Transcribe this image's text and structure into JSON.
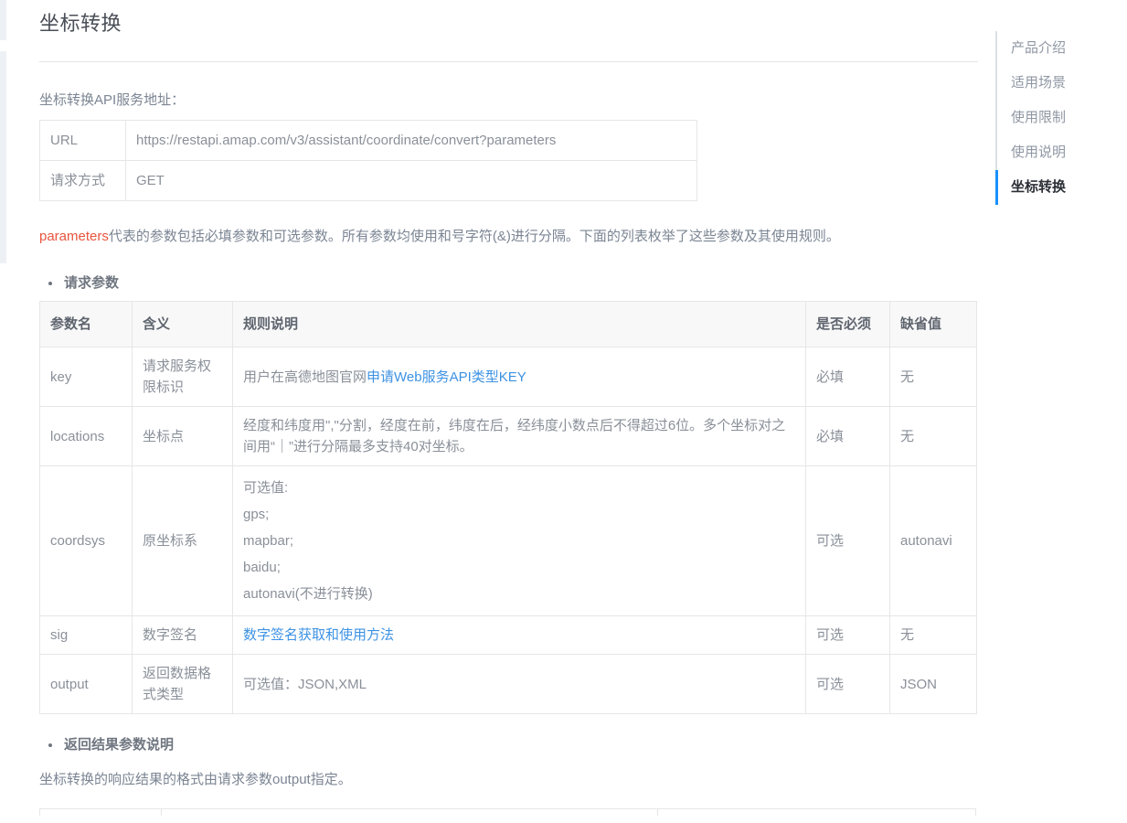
{
  "page": {
    "title": "坐标转换",
    "lead": "坐标转换API服务地址："
  },
  "service_table": {
    "rows": [
      {
        "label": "URL",
        "value": "https://restapi.amap.com/v3/assistant/coordinate/convert?parameters"
      },
      {
        "label": "请求方式",
        "value": "GET"
      }
    ]
  },
  "paragraph": {
    "code": "parameters",
    "text": "代表的参数包括必填参数和可选参数。所有参数均使用和号字符(&)进行分隔。下面的列表枚举了这些参数及其使用规则。"
  },
  "sections": {
    "request_params_heading": "请求参数",
    "response_params_heading": "返回结果参数说明",
    "response_note": "坐标转换的响应结果的格式由请求参数output指定。"
  },
  "param_table": {
    "headers": [
      "参数名",
      "含义",
      "规则说明",
      "是否必须",
      "缺省值"
    ],
    "rows": [
      {
        "name": "key",
        "meaning": "请求服务权限标识",
        "rule_prefix": "用户在高德地图官网",
        "rule_link": "申请Web服务API类型KEY",
        "rule_suffix": "",
        "required": "必填",
        "default": "无"
      },
      {
        "name": "locations",
        "meaning": "坐标点",
        "rule": "经度和纬度用\",\"分割，经度在前，纬度在后，经纬度小数点后不得超过6位。多个坐标对之间用“｜”进行分隔最多支持40对坐标。",
        "required": "必填",
        "default": "无"
      },
      {
        "name": "coordsys",
        "meaning": "原坐标系",
        "rule": "可选值:\ngps;\nmapbar;\nbaidu;\nautonavi(不进行转换)",
        "required": "可选",
        "default": "autonavi"
      },
      {
        "name": "sig",
        "meaning": "数字签名",
        "rule_link": "数字签名获取和使用方法",
        "required": "可选",
        "default": "无"
      },
      {
        "name": "output",
        "meaning": "返回数据格式类型",
        "rule": "可选值：JSON,XML",
        "required": "可选",
        "default": "JSON"
      }
    ]
  },
  "right_nav": {
    "items": [
      {
        "label": "产品介绍",
        "active": false
      },
      {
        "label": "适用场景",
        "active": false
      },
      {
        "label": "使用限制",
        "active": false
      },
      {
        "label": "使用说明",
        "active": false
      },
      {
        "label": "坐标转换",
        "active": true
      }
    ]
  },
  "colors": {
    "accent": "#1890ff",
    "link": "#3d92e3",
    "code_red": "#e8553e",
    "rail": "#edf1f5",
    "border": "#e6e6e6",
    "header_bg": "#f8f8f8"
  }
}
